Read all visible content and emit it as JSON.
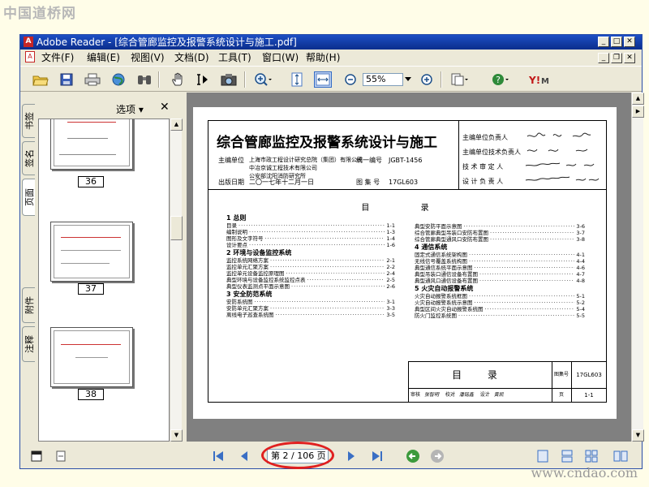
{
  "watermark_top": "中国道桥网",
  "watermark_bottom": "www.cndao.com",
  "window": {
    "title": "Adobe Reader - [综合管廊监控及报警系统设计与施工.pdf]",
    "app_badge": "A"
  },
  "menu": [
    "文件(F)",
    "编辑(E)",
    "视图(V)",
    "文档(D)",
    "工具(T)",
    "窗口(W)",
    "帮助(H)"
  ],
  "toolbar": {
    "zoom_value": "55%"
  },
  "nav_panel": {
    "tabs": [
      "书签",
      "签名",
      "页面",
      "附件",
      "注释"
    ],
    "options_label": "选项 ▾",
    "close_label": "✕",
    "thumbnails": [
      "36",
      "37",
      "38"
    ]
  },
  "document": {
    "title": "综合管廊监控及报警系统设计与施工",
    "editor_label": "主编单位",
    "editor_org": "上海市政工程设计研究总院（集团）有限公司",
    "co_org_1": "中冶京诚工程技术有限公司",
    "co_org_2": "公安部沈阳消防研究所",
    "number_label": "统一编号",
    "number_value": "JGBT-1456",
    "date_label": "出版日期",
    "date_value": "二〇一七年十二月一日",
    "atlas_label": "图 集 号",
    "atlas_value": "17GL603",
    "right_labels": [
      "主编单位负责人",
      "主编单位技术负责人",
      "技 术 审 定 人",
      "设 计 负 责 人"
    ],
    "toc_heading": "目 录",
    "toc_left": [
      {
        "t": "1 总则",
        "p": "",
        "sec": true
      },
      {
        "t": "目录",
        "p": "1-1"
      },
      {
        "t": "编制说明",
        "p": "1-3"
      },
      {
        "t": "图形及文字符号",
        "p": "1-4"
      },
      {
        "t": "设计要点",
        "p": "1-6"
      },
      {
        "t": "2 环境与设备监控系统",
        "p": "",
        "sec": true
      },
      {
        "t": "监控系统网络方案",
        "p": "2-1"
      },
      {
        "t": "监控单元汇聚方案",
        "p": "2-2"
      },
      {
        "t": "监控单元设备监控原理图",
        "p": "2-4"
      },
      {
        "t": "典型环境与设备监控系统监控点表",
        "p": "2-5"
      },
      {
        "t": "典型仪表监测点平面示意图",
        "p": "2-6"
      },
      {
        "t": "3 安全防范系统",
        "p": "",
        "sec": true
      },
      {
        "t": "安防系统图",
        "p": "3-1"
      },
      {
        "t": "安防单元汇聚方案",
        "p": "3-3"
      },
      {
        "t": "离线电子巡查系统图",
        "p": "3-5"
      }
    ],
    "toc_right": [
      {
        "t": "典型安防平面示意图",
        "p": "3-6"
      },
      {
        "t": "综合管廊典型吊装口安防布置图",
        "p": "3-7"
      },
      {
        "t": "综合管廊典型通风口安防布置图",
        "p": "3-8"
      },
      {
        "t": "4 通信系统",
        "p": "",
        "sec": true
      },
      {
        "t": "固定式通信系统架构图",
        "p": "4-1"
      },
      {
        "t": "无线信号覆盖系统构图",
        "p": "4-4"
      },
      {
        "t": "典型通信系统平面示意图",
        "p": "4-6"
      },
      {
        "t": "典型吊装口通信设备布置图",
        "p": "4-7"
      },
      {
        "t": "典型通风口通信设备布置图",
        "p": "4-8"
      },
      {
        "t": "5 火灾自动报警系统",
        "p": "",
        "sec": true
      },
      {
        "t": "火灾自动报警系统框图",
        "p": "5-1"
      },
      {
        "t": "火灾自动报警系统示意图",
        "p": "5-2"
      },
      {
        "t": "典型区间火灾自动报警系统图",
        "p": "5-4"
      },
      {
        "t": "防火门监控系统图",
        "p": "5-5"
      }
    ],
    "table": {
      "title": "目 录",
      "atlas_label": "图集号",
      "atlas_value": "17GL603",
      "page_label": "页",
      "page_value": "1-1",
      "row_labels": [
        "审核",
        "张智明",
        "校对",
        "潘铭鑫",
        "设计",
        "黄凯"
      ]
    }
  },
  "status": {
    "page_indicator": "第 2 / 106 页"
  }
}
